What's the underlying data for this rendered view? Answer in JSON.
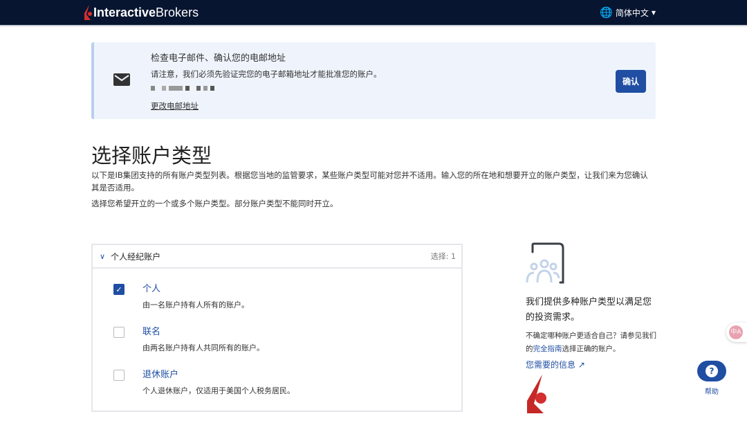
{
  "header": {
    "logo_bold": "Interactive",
    "logo_light": "Brokers",
    "language": "简体中文"
  },
  "banner": {
    "title": "检查电子邮件、确认您的电邮地址",
    "subtitle": "请注意，我们必须先验证完您的电子邮箱地址才能批准您的账户。",
    "change_link": "更改电邮地址",
    "confirm_button": "确认"
  },
  "main": {
    "title": "选择账户类型",
    "intro": "以下是IB集团支持的所有账户类型列表。根据您当地的监管要求，某些账户类型可能对您并不适用。输入您的所在地和想要开立的账户类型，让我们来为您确认其是否适用。",
    "instruction": "选择您希望开立的一个或多个账户类型。部分账户类型不能同时开立。"
  },
  "panel": {
    "title": "个人经纪账户",
    "count": "选择: 1",
    "options": [
      {
        "label": "个人",
        "desc": "由一名账户持有人所有的账户。",
        "checked": true
      },
      {
        "label": "联名",
        "desc": "由两名账户持有人共同所有的账户。",
        "checked": false
      },
      {
        "label": "退休账户",
        "desc": "个人退休账户，仅适用于美国个人税务居民。",
        "checked": false
      }
    ]
  },
  "side": {
    "title": "我们提供多种账户类型以满足您的投资需求。",
    "desc_before": "不确定哪种账户更适合自己？请参见我们的",
    "guide_link": "完全指南",
    "desc_after": "选择正确的账户。",
    "info_link": "您需要的信息"
  },
  "help": {
    "label": "帮助"
  },
  "colors": {
    "brand": "#1f4ea3",
    "nav": "#071530",
    "logo_red": "#d32f2f"
  }
}
